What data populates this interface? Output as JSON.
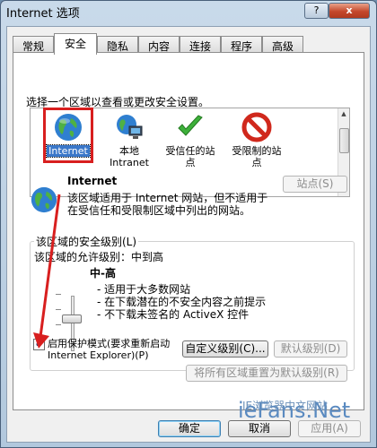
{
  "window": {
    "title": "Internet 选项",
    "help_glyph": "?",
    "close_glyph": "x"
  },
  "tabs": [
    {
      "label": "常规"
    },
    {
      "label": "安全"
    },
    {
      "label": "隐私"
    },
    {
      "label": "内容"
    },
    {
      "label": "连接"
    },
    {
      "label": "程序"
    },
    {
      "label": "高级"
    }
  ],
  "security": {
    "zone_prompt": "选择一个区域以查看或更改安全设置。",
    "zones": [
      {
        "label": "Internet",
        "icon": "globe-icon"
      },
      {
        "label": "本地\nIntranet",
        "icon": "network-icon"
      },
      {
        "label": "受信任的站\n点",
        "icon": "checkmark-icon"
      },
      {
        "label": "受限制的站\n点",
        "icon": "no-entry-icon"
      }
    ],
    "selected_zone": {
      "title": "Internet",
      "description": "该区域适用于 Internet 网站，但不适用于\n在受信任和受限制区域中列出的网站。",
      "sites_button": "站点(S)"
    },
    "level_group": {
      "legend": "该区域的安全级别(L)",
      "allowed_levels": "该区域的允许级别：中到高",
      "current_level": "中-高",
      "bullets": [
        "- 适用于大多数网站",
        "- 在下载潜在的不安全内容之前提示",
        "- 不下载未签名的 ActiveX 控件"
      ],
      "slider_fraction": 0.5
    },
    "protected_mode_label": "启用保护模式(要求重新启动\nInternet Explorer)(P)",
    "protected_mode_checked": true,
    "custom_level_button": "自定义级别(C)...",
    "default_level_button": "默认级别(D)",
    "reset_all_button": "将所有区域重置为默认级别(R)"
  },
  "footer": {
    "ok": "确定",
    "cancel": "取消",
    "apply": "应用(A)"
  },
  "watermark": {
    "brand": "ieFans.Net",
    "sub": "IE浏览器中文网站"
  },
  "colors": {
    "accent": "#3a77c9",
    "highlight": "#d81f1f"
  }
}
